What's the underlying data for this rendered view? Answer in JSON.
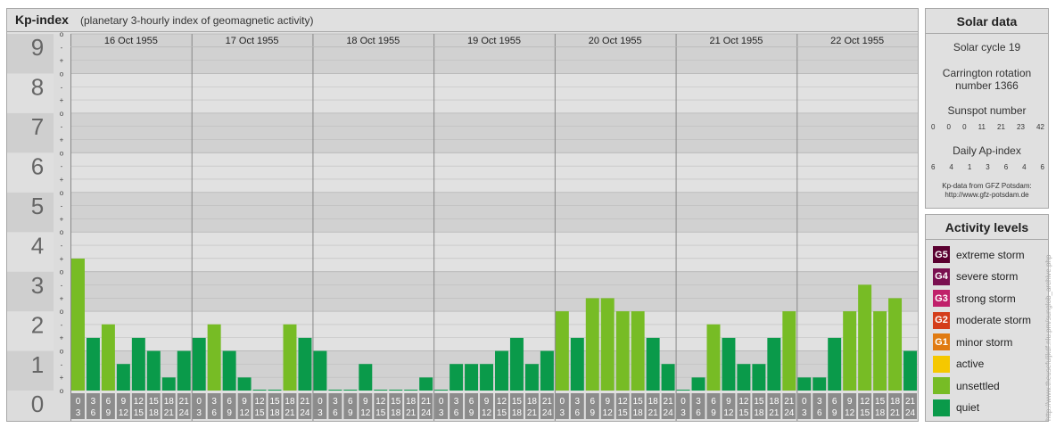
{
  "header": {
    "title": "Kp-index",
    "subtitle": "(planetary 3-hourly index of geomagnetic activity)"
  },
  "chart_data": {
    "type": "bar",
    "title": "Kp-index",
    "subtitle": "(planetary 3-hourly index of geomagnetic activity)",
    "ylim": [
      0,
      9
    ],
    "y_ticks": [
      "0",
      "1",
      "2",
      "3",
      "4",
      "5",
      "6",
      "7",
      "8",
      "9"
    ],
    "sub_ticks": [
      "o",
      "+",
      "-"
    ],
    "days": [
      "16 Oct 1955",
      "17 Oct 1955",
      "18 Oct 1955",
      "19 Oct 1955",
      "20 Oct 1955",
      "21 Oct 1955",
      "22 Oct 1955"
    ],
    "interval_starts": [
      "0",
      "3",
      "6",
      "9",
      "12",
      "15",
      "18",
      "21"
    ],
    "interval_ends": [
      "3",
      "6",
      "9",
      "12",
      "15",
      "18",
      "21",
      "24"
    ],
    "values": [
      [
        3.33,
        1.33,
        1.67,
        0.67,
        1.33,
        1.0,
        0.33,
        1.0
      ],
      [
        1.33,
        1.67,
        1.0,
        0.33,
        0.0,
        0.0,
        1.67,
        1.33
      ],
      [
        1.0,
        0.0,
        0.0,
        0.67,
        0.0,
        0.0,
        0.0,
        0.33
      ],
      [
        0.0,
        0.67,
        0.67,
        0.67,
        1.0,
        1.33,
        0.67,
        1.0
      ],
      [
        2.0,
        1.33,
        2.33,
        2.33,
        2.0,
        2.0,
        1.33,
        0.67
      ],
      [
        0.0,
        0.33,
        1.67,
        1.33,
        0.67,
        0.67,
        1.33,
        2.0
      ],
      [
        0.33,
        0.33,
        1.33,
        2.0,
        2.67,
        2.0,
        2.33,
        1.0
      ]
    ],
    "grid": true,
    "colors": {
      "quiet": "#0a9a4a",
      "unsettled": "#77bc25",
      "active": "#f5c800"
    }
  },
  "solar": {
    "title": "Solar data",
    "cycle": "Solar cycle 19",
    "carrington_line1": "Carrington rotation",
    "carrington_line2": "number 1366",
    "sunspot_label": "Sunspot number",
    "sunspot_values": [
      "0",
      "0",
      "0",
      "11",
      "21",
      "23",
      "42"
    ],
    "ap_label": "Daily Ap-index",
    "ap_values": [
      "6",
      "4",
      "1",
      "3",
      "6",
      "4",
      "6"
    ],
    "credit_line1": "Kp-data from GFZ Potsdam:",
    "credit_line2": "http://www.gfz-potsdam.de"
  },
  "activity": {
    "title": "Activity levels",
    "levels": [
      {
        "code": "G5",
        "label": "extreme storm",
        "color": "#5a0030"
      },
      {
        "code": "G4",
        "label": "severe storm",
        "color": "#7a1050"
      },
      {
        "code": "G3",
        "label": "strong storm",
        "color": "#c0206a"
      },
      {
        "code": "G2",
        "label": "moderate storm",
        "color": "#d43d1a"
      },
      {
        "code": "G1",
        "label": "minor storm",
        "color": "#e07b12"
      },
      {
        "code": "",
        "label": "active",
        "color": "#f5c800"
      },
      {
        "code": "",
        "label": "unsettled",
        "color": "#77bc25"
      },
      {
        "code": "",
        "label": "quiet",
        "color": "#0a9a4a"
      }
    ]
  },
  "watermark": "http://www.theusefuljkdf.nlu.pm/sunglob_archive.php"
}
